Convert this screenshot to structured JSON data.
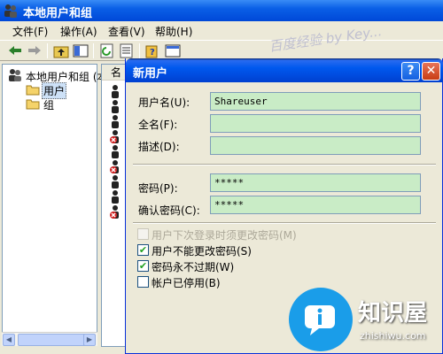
{
  "window": {
    "title": "本地用户和组"
  },
  "menu": {
    "items": [
      "文件(F)",
      "操作(A)",
      "查看(V)",
      "帮助(H)"
    ]
  },
  "tree": {
    "root": "本地用户和组 (本",
    "items": [
      "用户",
      "组"
    ]
  },
  "list": {
    "column_header": "名"
  },
  "dialog": {
    "title": "新用户",
    "help_glyph": "?",
    "close_glyph": "✕",
    "username": {
      "label": "用户名(U):",
      "value": "Shareuser"
    },
    "fullname": {
      "label": "全名(F):",
      "value": ""
    },
    "description": {
      "label": "描述(D):",
      "value": ""
    },
    "password": {
      "label": "密码(P):",
      "value": "*****"
    },
    "confirm_password": {
      "label": "确认密码(C):",
      "value": "*****"
    },
    "options": [
      {
        "label": "用户下次登录时须更改密码(M)",
        "checked": false,
        "disabled": true
      },
      {
        "label": "用户不能更改密码(S)",
        "checked": true,
        "disabled": false
      },
      {
        "label": "密码永不过期(W)",
        "checked": true,
        "disabled": false
      },
      {
        "label": "帐户已停用(B)",
        "checked": false,
        "disabled": false
      }
    ]
  },
  "watermark": {
    "text": "百度经验 by Key..."
  },
  "logo": {
    "brand": "知识屋",
    "domain": "zhishiwu.com"
  },
  "colors": {
    "title_blue": "#0058ee",
    "field_green": "#c9ecc6",
    "close_red": "#c83c14",
    "logo_blue": "#1a9de9"
  }
}
